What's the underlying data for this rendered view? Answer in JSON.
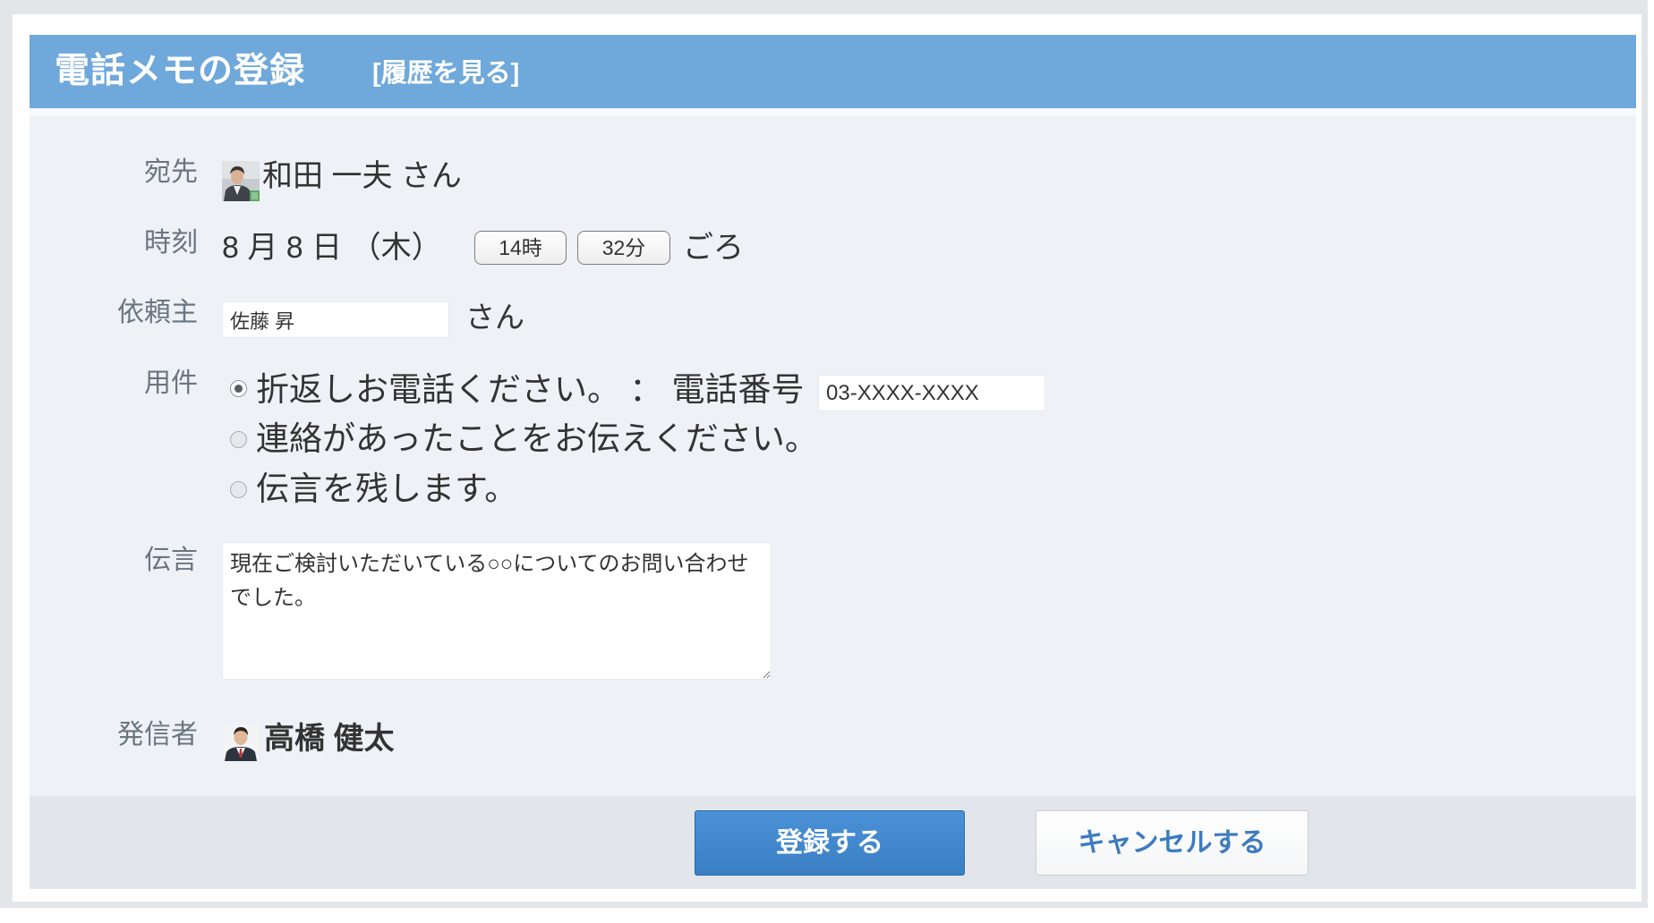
{
  "header": {
    "title": "電話メモの登録",
    "history_link": "[履歴を見る]"
  },
  "colors": {
    "header_bg": "#6fa8da",
    "body_bg": "#eef2f6",
    "footer_bg": "#e2e6ea",
    "label": "#6a7580",
    "primary_button": "#3a7fc4",
    "cancel_text": "#3c7cbf"
  },
  "icons": {
    "recipient_avatar": "user-photo-icon",
    "sender_avatar": "user-photo-icon"
  },
  "form": {
    "recipient": {
      "label": "宛先",
      "name": "和田 一夫 さん"
    },
    "time": {
      "label": "時刻",
      "date": "8 月 8 日 （木）",
      "hour": "14時",
      "minute": "32分",
      "suffix": "ごろ"
    },
    "requester": {
      "label": "依頼主",
      "value": "佐藤 昇",
      "suffix": "さん"
    },
    "purpose": {
      "label": "用件",
      "options": [
        {
          "label": "折返しお電話ください。 ： 電話番号",
          "checked": true
        },
        {
          "label": "連絡があったことをお伝えください。",
          "checked": false
        },
        {
          "label": "伝言を残します。",
          "checked": false
        }
      ],
      "phone_value": "03-XXXX-XXXX"
    },
    "message": {
      "label": "伝言",
      "value": "現在ご検討いただいている○○についてのお問い合わせでした。"
    },
    "sender": {
      "label": "発信者",
      "name": "高橋 健太"
    }
  },
  "footer": {
    "submit_label": "登録する",
    "cancel_label": "キャンセルする"
  }
}
